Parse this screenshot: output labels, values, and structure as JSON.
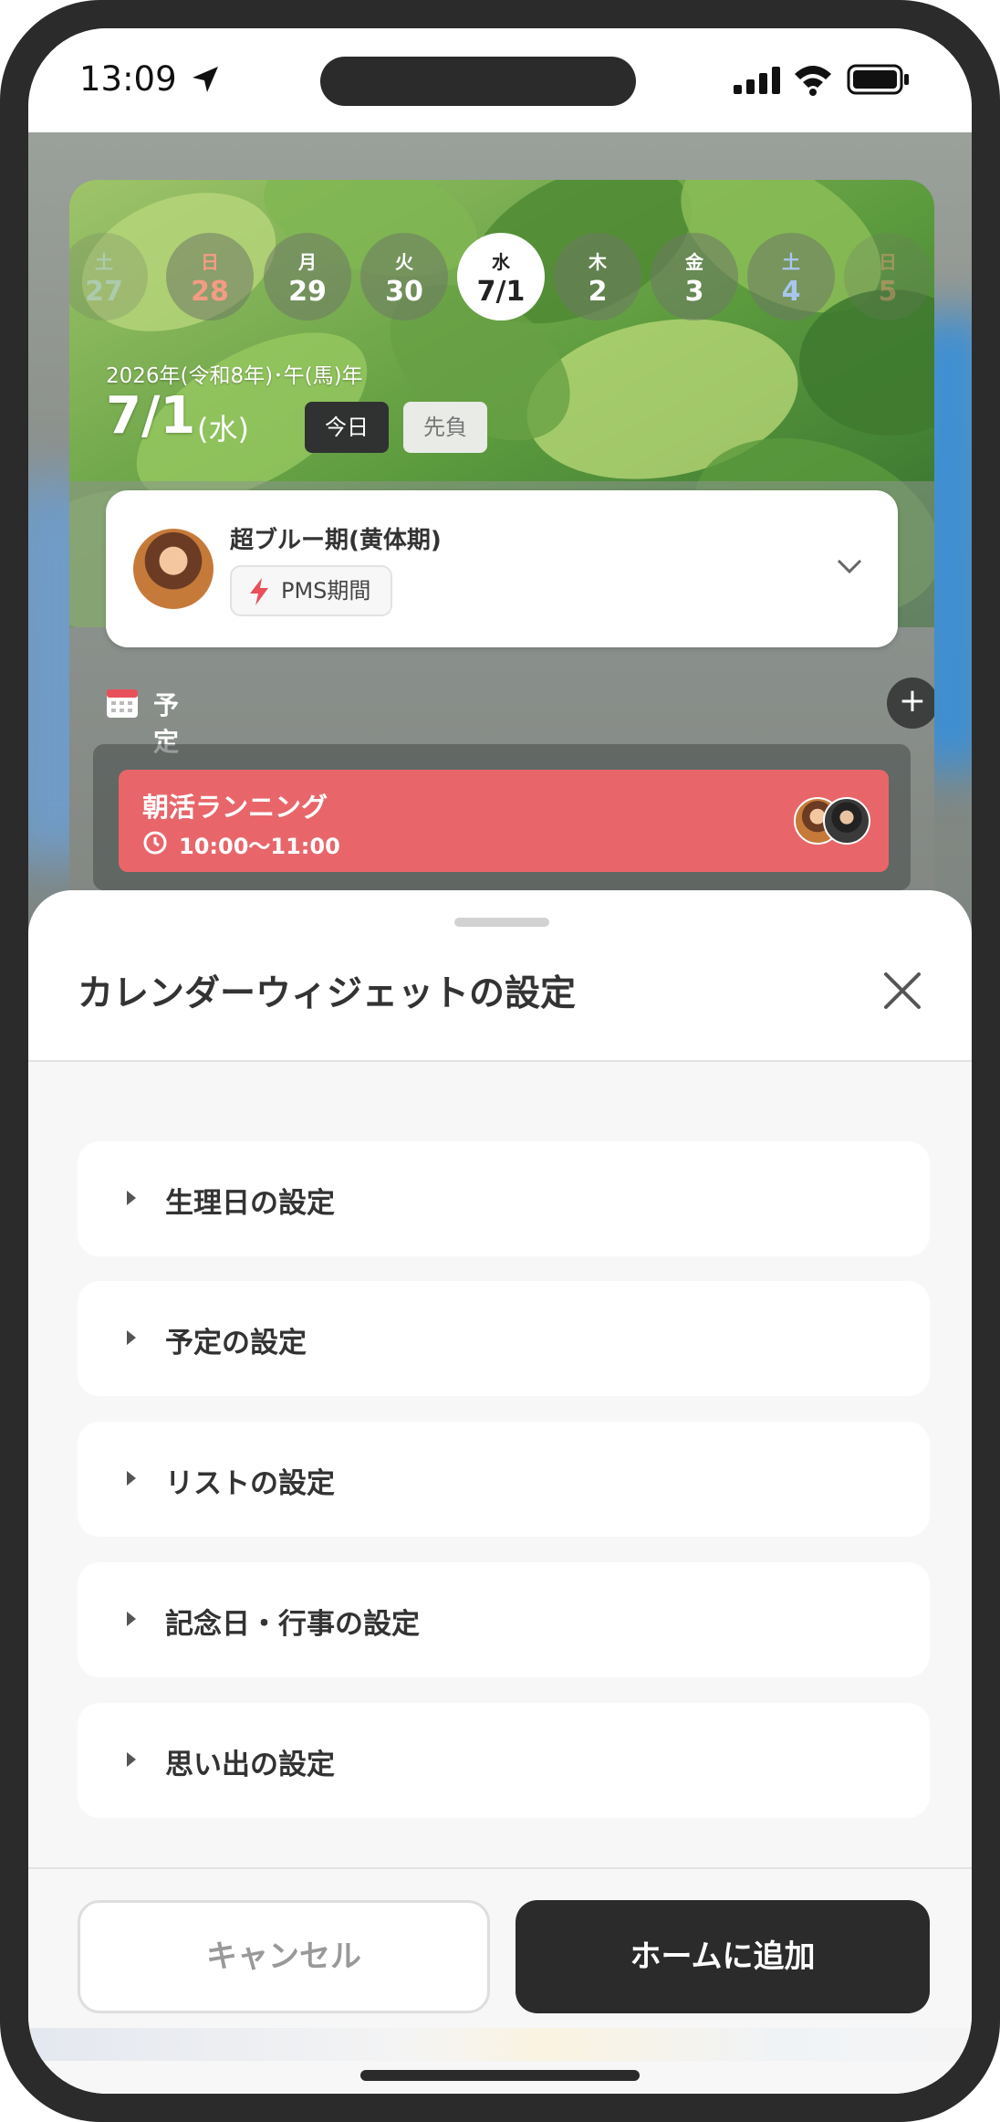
{
  "status_bar": {
    "time": "13:09"
  },
  "widget": {
    "days": [
      {
        "dow": "土",
        "num": "27"
      },
      {
        "dow": "日",
        "num": "28"
      },
      {
        "dow": "月",
        "num": "29"
      },
      {
        "dow": "火",
        "num": "30"
      },
      {
        "dow": "水",
        "num": "7/1"
      },
      {
        "dow": "木",
        "num": "2"
      },
      {
        "dow": "金",
        "num": "3"
      },
      {
        "dow": "土",
        "num": "4"
      },
      {
        "dow": "日",
        "num": "5"
      }
    ],
    "era_line": "2026年(令和8年)･午(馬)年",
    "date": "7/1",
    "weekday": "(水)",
    "today_label": "今日",
    "rokuyo": "先負",
    "cycle": {
      "title": "超ブルー期(黄体期)",
      "badge": "PMS期間"
    },
    "schedule": {
      "label": "予定",
      "add_label": "+",
      "event": {
        "title": "朝活ランニング",
        "time": "10:00〜11:00"
      }
    },
    "colors": {
      "event": "#e8666a",
      "sunday": "#f49b84",
      "saturday": "#a9c6ef"
    }
  },
  "sheet": {
    "title": "カレンダーウィジェットの設定",
    "sections": [
      "生理日の設定",
      "予定の設定",
      "リストの設定",
      "記念日・行事の設定",
      "思い出の設定"
    ],
    "cancel_label": "キャンセル",
    "add_label": "ホームに追加"
  }
}
